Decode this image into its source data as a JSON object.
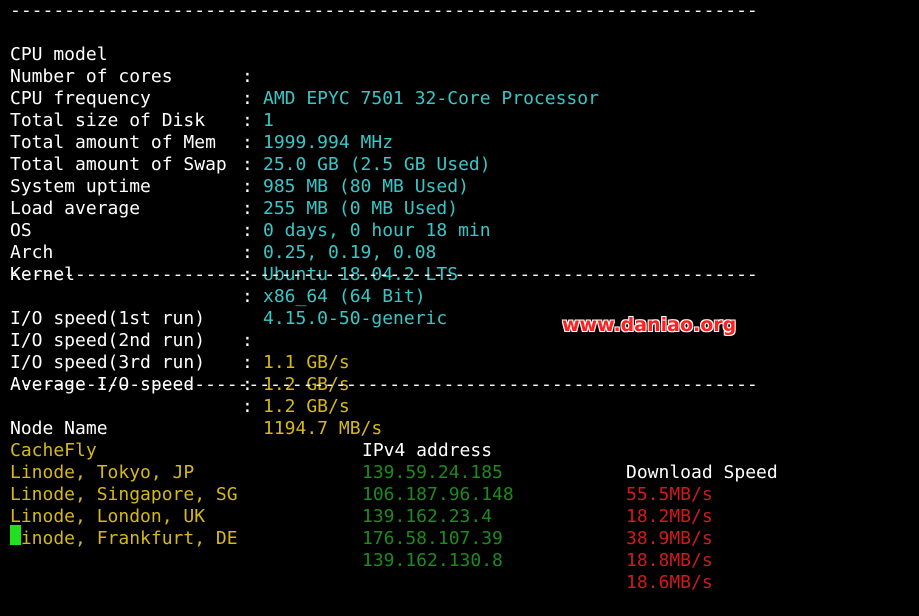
{
  "separator": "---------------------------------------------------------------------",
  "colon": ":",
  "sysinfo": [
    {
      "key": "CPU model",
      "value": "AMD EPYC 7501 32-Core Processor"
    },
    {
      "key": "Number of cores",
      "value": "1"
    },
    {
      "key": "CPU frequency",
      "value": "1999.994 MHz"
    },
    {
      "key": "Total size of Disk",
      "value": "25.0 GB (2.5 GB Used)"
    },
    {
      "key": "Total amount of Mem",
      "value": "985 MB (80 MB Used)"
    },
    {
      "key": "Total amount of Swap",
      "value": "255 MB (0 MB Used)"
    },
    {
      "key": "System uptime",
      "value": "0 days, 0 hour 18 min"
    },
    {
      "key": "Load average",
      "value": "0.25, 0.19, 0.08"
    },
    {
      "key": "OS",
      "value": "Ubuntu 18.04.2 LTS"
    },
    {
      "key": "Arch",
      "value": "x86_64 (64 Bit)"
    },
    {
      "key": "Kernel",
      "value": "4.15.0-50-generic"
    }
  ],
  "io": [
    {
      "key": "I/O speed(1st run)",
      "value": "1.1 GB/s"
    },
    {
      "key": "I/O speed(2nd run)",
      "value": "1.2 GB/s"
    },
    {
      "key": "I/O speed(3rd run)",
      "value": "1.2 GB/s"
    },
    {
      "key": "Average I/O speed",
      "value": "1194.7 MB/s"
    }
  ],
  "speedtest": {
    "headers": [
      "Node Name",
      "IPv4 address",
      "Download Speed"
    ],
    "rows": [
      {
        "node": "CacheFly",
        "ip": "139.59.24.185",
        "speed": "55.5MB/s"
      },
      {
        "node": "Linode, Tokyo, JP",
        "ip": "106.187.96.148",
        "speed": "18.2MB/s"
      },
      {
        "node": "Linode, Singapore, SG",
        "ip": "139.162.23.4",
        "speed": "38.9MB/s"
      },
      {
        "node": "Linode, London, UK",
        "ip": "176.58.107.39",
        "speed": "18.8MB/s"
      },
      {
        "node": "Linode, Frankfurt, DE",
        "ip": "139.162.130.8",
        "speed": "18.6MB/s"
      }
    ]
  },
  "watermark": "www.daniao.org",
  "colors": {
    "background": "#000000",
    "value_cyan": "#39c6c6",
    "value_yellow": "#d6b915",
    "ip_green": "#1e8a1e",
    "speed_red": "#d11a1a",
    "cursor_green": "#20e020"
  }
}
